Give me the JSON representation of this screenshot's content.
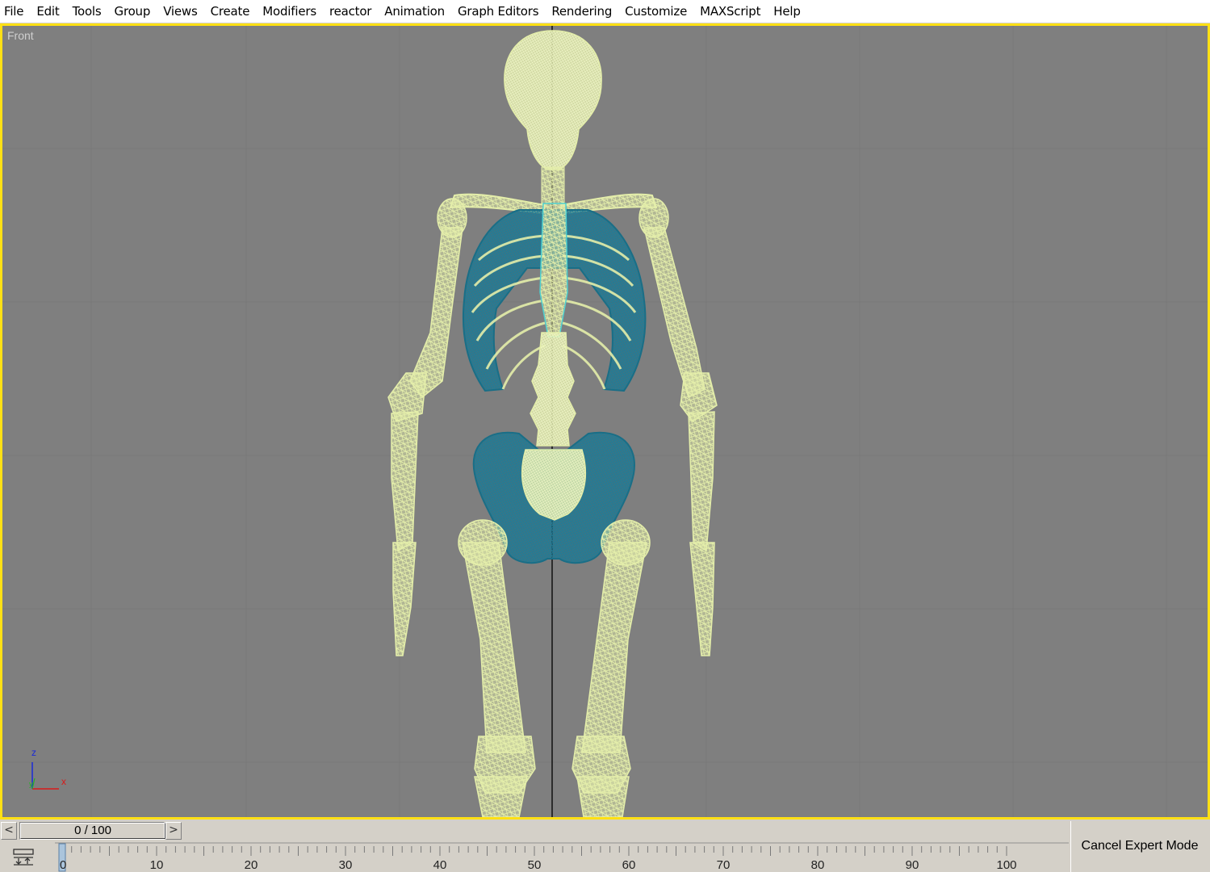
{
  "menu": [
    "File",
    "Edit",
    "Tools",
    "Group",
    "Views",
    "Create",
    "Modifiers",
    "reactor",
    "Animation",
    "Graph Editors",
    "Rendering",
    "Customize",
    "MAXScript",
    "Help"
  ],
  "viewport": {
    "label": "Front",
    "border_color": "#ffe014",
    "background": "#7f7f7f",
    "bone_color": "#e4eeaa",
    "rib_color": "#1a6e86"
  },
  "axis_gizmo": {
    "z": "z",
    "x": "x",
    "y": "y"
  },
  "time_slider": {
    "value": "0 / 100",
    "prev_label": "<",
    "next_label": ">"
  },
  "trackbar": {
    "ticks": [
      "0",
      "10",
      "20",
      "30",
      "40",
      "50",
      "60",
      "70",
      "80",
      "90",
      "100"
    ],
    "current_frame": "0"
  },
  "expert_mode": {
    "label": "Cancel Expert Mode"
  }
}
